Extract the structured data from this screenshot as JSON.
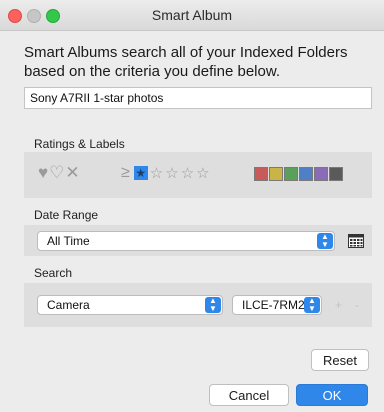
{
  "window": {
    "title": "Smart Album"
  },
  "intro_text": "Smart Albums search all of your Indexed Folders based on the criteria you define below.",
  "album_name": {
    "value": "Sony A7RII 1-star photos"
  },
  "sections": {
    "ratings_labels": "Ratings & Labels",
    "date_range": "Date Range",
    "search": "Search"
  },
  "ratings": {
    "comparator": "≥",
    "selected_stars": 1,
    "total_stars": 5
  },
  "label_colors": [
    "#c85a5a",
    "#c9b547",
    "#5aa05a",
    "#4f7fc4",
    "#8a6bb6",
    "#5a5a5a"
  ],
  "date_range": {
    "selected": "All Time"
  },
  "search": {
    "field": "Camera",
    "value": "ILCE-7RM2",
    "add": "+",
    "remove": "-"
  },
  "buttons": {
    "reset": "Reset",
    "cancel": "Cancel",
    "ok": "OK"
  },
  "icons": {
    "label_filters": [
      "heart-filled-icon",
      "heart-outline-icon",
      "cross-icon"
    ],
    "calendar": "calendar-icon",
    "stepper": "chevron-updown-icon"
  },
  "accent_color": "#2f87e9"
}
